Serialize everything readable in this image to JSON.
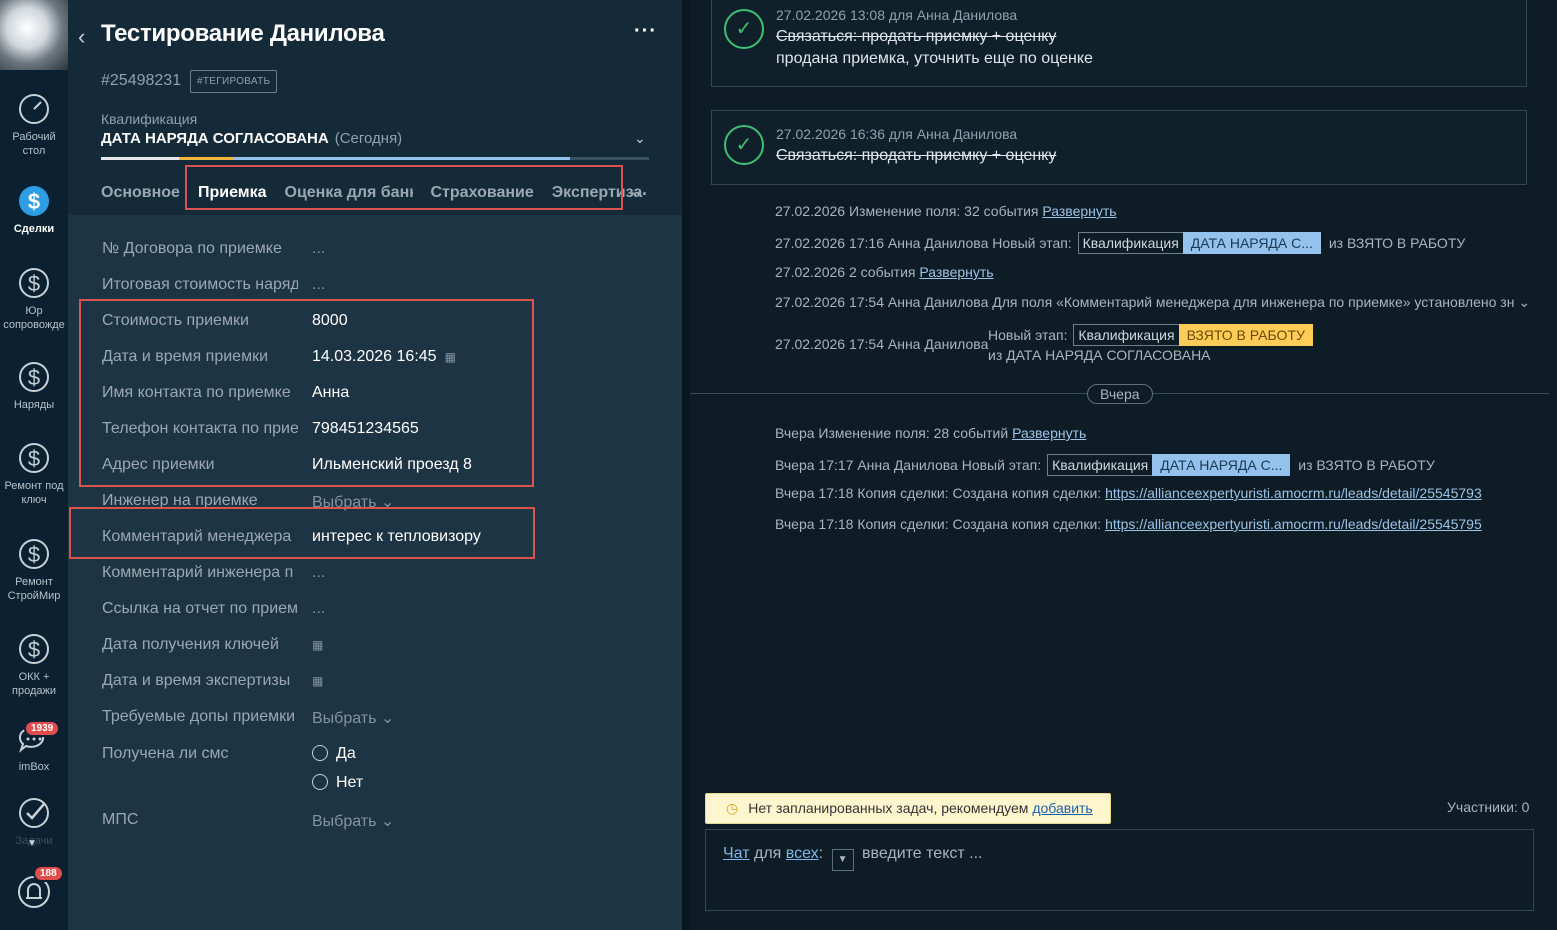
{
  "nav": {
    "items": [
      {
        "label": "Рабочий стол",
        "icon": "speedometer-icon"
      },
      {
        "label": "Сделки",
        "icon": "dollar-icon"
      },
      {
        "label": "Юр сопровожде",
        "icon": "dollar-icon"
      },
      {
        "label": "Наряды",
        "icon": "dollar-icon"
      },
      {
        "label": "Ремонт под ключ",
        "icon": "dollar-icon"
      },
      {
        "label": "Ремонт СтройМир",
        "icon": "dollar-icon"
      },
      {
        "label": "ОКК + продажи",
        "icon": "dollar-icon"
      },
      {
        "label": "imBox",
        "icon": "chat-icon",
        "badge": "1939"
      },
      {
        "label": "Задачи",
        "icon": "checkmark-icon"
      },
      {
        "label": "",
        "icon": "bell-icon",
        "badge": "188"
      }
    ]
  },
  "card": {
    "title": "Тестирование Данилова",
    "lead_id": "#25498231",
    "tag_button": "#ТЕГИРОВАТЬ",
    "stage_label": "Квалификация",
    "stage_value": "ДАТА НАРЯДА СОГЛАСОВАНА",
    "stage_date": "(Сегодня)",
    "tabs": [
      "Основное",
      "Приемка",
      "Оценка для банка",
      "Страхование",
      "Экспертиза"
    ],
    "fields": [
      {
        "label": "№ Договора по приемке",
        "value": "..."
      },
      {
        "label": "Итоговая стоимость наряд",
        "value": "..."
      },
      {
        "label": "Стоимость приемки",
        "value": "8000"
      },
      {
        "label": "Дата и время приемки",
        "value": "14.03.2026 16:45"
      },
      {
        "label": "Имя контакта по приемке",
        "value": "Анна"
      },
      {
        "label": "Телефон контакта по прие",
        "value": "798451234565"
      },
      {
        "label": "Адрес приемки",
        "value": "Ильменский проезд 8"
      },
      {
        "label": "Инженер на приемке",
        "value": "Выбрать"
      },
      {
        "label": "Комментарий менеджера",
        "value": "интерес к тепловизору"
      },
      {
        "label": "Комментарий инженера п",
        "value": "..."
      },
      {
        "label": "Ссылка на отчет по прием",
        "value": "..."
      },
      {
        "label": "Дата получения ключей",
        "value": ""
      },
      {
        "label": "Дата и время экспертизы",
        "value": ""
      },
      {
        "label": "Требуемые допы приемки",
        "value": "Выбрать"
      },
      {
        "label": "Получена ли смс",
        "options": [
          "Да",
          "Нет"
        ]
      },
      {
        "label": "МПС",
        "value": "Выбрать"
      }
    ]
  },
  "feed": {
    "notes": [
      {
        "meta": "27.02.2026 13:08  для Анна Данилова",
        "task": "Связаться: продать приемку + оценку",
        "result": "продана приемка, уточнить еще по оценке"
      },
      {
        "meta": "27.02.2026 16:36  для Анна Данилова",
        "task": "Связаться: продать приемку + оценку"
      }
    ],
    "events": [
      {
        "text": "27.02.2026 Изменение поля: 32 события",
        "link": "Развернуть"
      },
      {
        "text": "27.02.2026 17:16 Анна Данилова Новый этап:",
        "pipeline": "Квалификация",
        "stage": "ДАТА НАРЯДА С...",
        "from": "из ВЗЯТО В РАБОТУ"
      },
      {
        "text": "27.02.2026 2 события",
        "link": "Развернуть"
      },
      {
        "text": "27.02.2026 17:54 Анна Данилова Для поля «Комментарий менеджера для инженера по приемке» установлено зн"
      },
      {
        "text": "27.02.2026 17:54 Анна Данилова",
        "new_stage": "Новый этап:",
        "pipeline": "Квалификация",
        "stage": "ВЗЯТО В РАБОТУ",
        "from": "из ДАТА НАРЯДА СОГЛАСОВАНА"
      }
    ],
    "day_separator": "Вчера",
    "events_yesterday": [
      {
        "text": "Вчера Изменение поля: 28 событий",
        "link": "Развернуть"
      },
      {
        "text": "Вчера 17:17 Анна Данилова Новый этап:",
        "pipeline": "Квалификация",
        "stage": "ДАТА НАРЯДА С...",
        "from": "из ВЗЯТО В РАБОТУ"
      },
      {
        "text": "Вчера 17:18 Копия сделки: Создана копия сделки:",
        "link": "https://allianceexpertyuristi.amocrm.ru/leads/detail/25545793"
      },
      {
        "text": "Вчера 17:18 Копия сделки: Создана копия сделки:",
        "link": "https://allianceexpertyuristi.amocrm.ru/leads/detail/25545795"
      }
    ],
    "task_bar": {
      "text": "Нет запланированных задач, рекомендуем",
      "link": "добавить"
    },
    "participants": "Участники: 0",
    "chat": {
      "mode": "Чат",
      "for": "для",
      "target": "всех",
      "placeholder": "введите текст ..."
    }
  }
}
